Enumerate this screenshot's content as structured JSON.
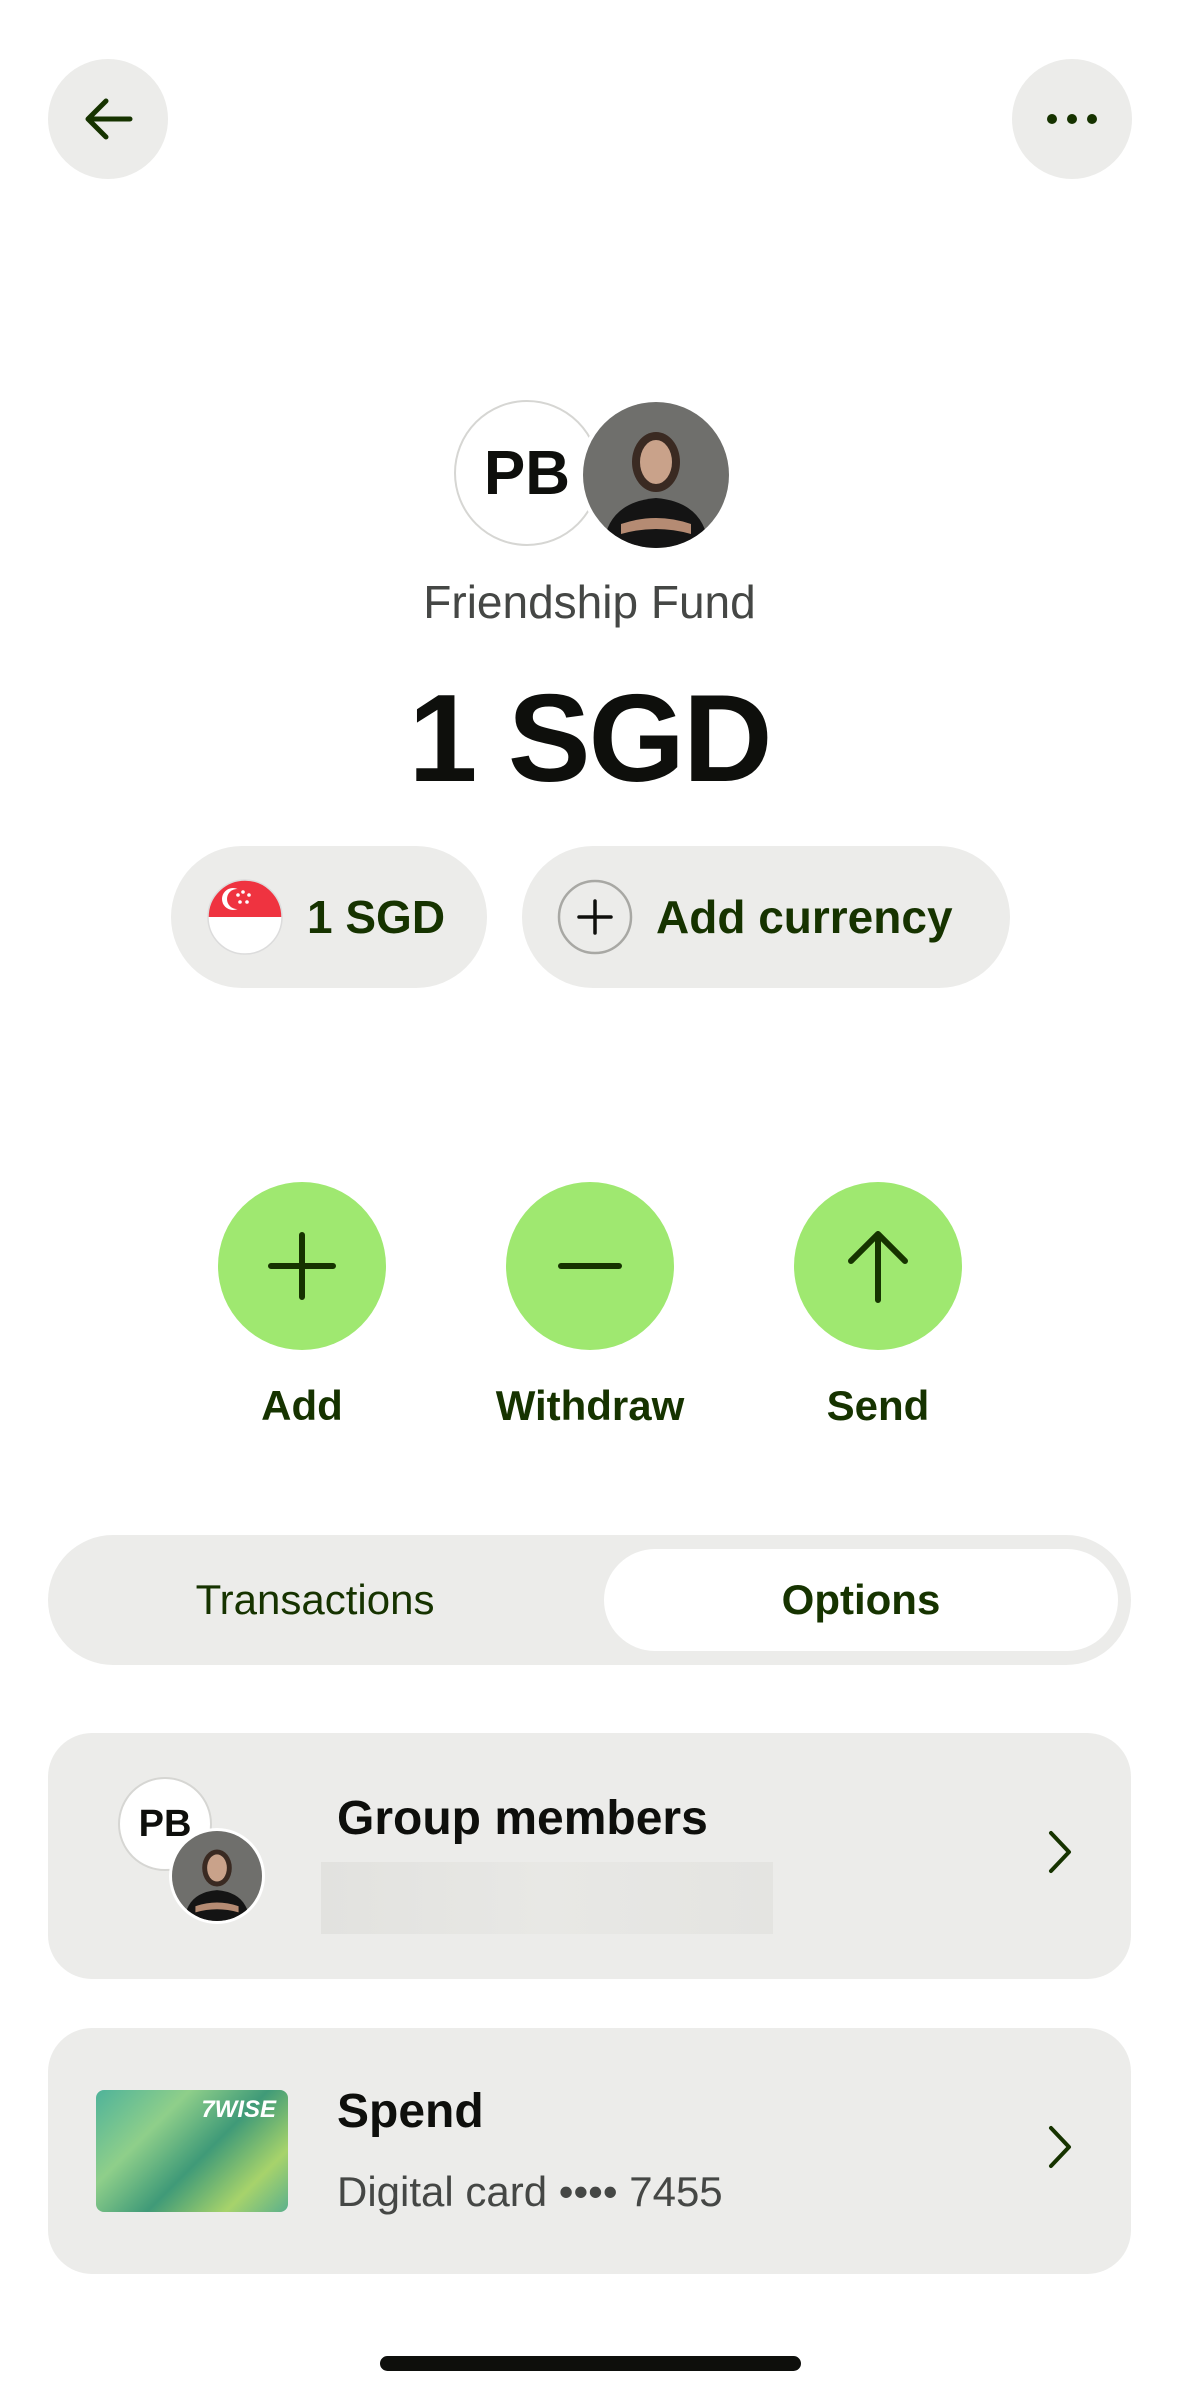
{
  "header": {
    "back_icon": "arrow-left-icon",
    "more_icon": "more-horizontal-icon"
  },
  "account": {
    "initials": "PB",
    "name": "Friendship Fund",
    "balance": "1 SGD"
  },
  "currency_pill": {
    "flag_icon": "singapore-flag-icon",
    "label": "1 SGD"
  },
  "add_currency": {
    "icon": "plus-circle-icon",
    "label": "Add currency"
  },
  "actions": [
    {
      "icon": "plus-icon",
      "label": "Add"
    },
    {
      "icon": "minus-icon",
      "label": "Withdraw"
    },
    {
      "icon": "arrow-up-icon",
      "label": "Send"
    }
  ],
  "tabs": {
    "transactions": "Transactions",
    "options": "Options",
    "selected": "Options"
  },
  "cards": {
    "members": {
      "initials": "PB",
      "title": "Group members"
    },
    "spend": {
      "card_brand": "7WISE",
      "title": "Spend",
      "subtitle": "Digital card •••• 7455"
    }
  },
  "colors": {
    "accent_green": "#9fe870",
    "dark_green": "#163300",
    "surface": "#ececea",
    "text_primary": "#0e0f0c",
    "text_secondary": "#454745"
  }
}
